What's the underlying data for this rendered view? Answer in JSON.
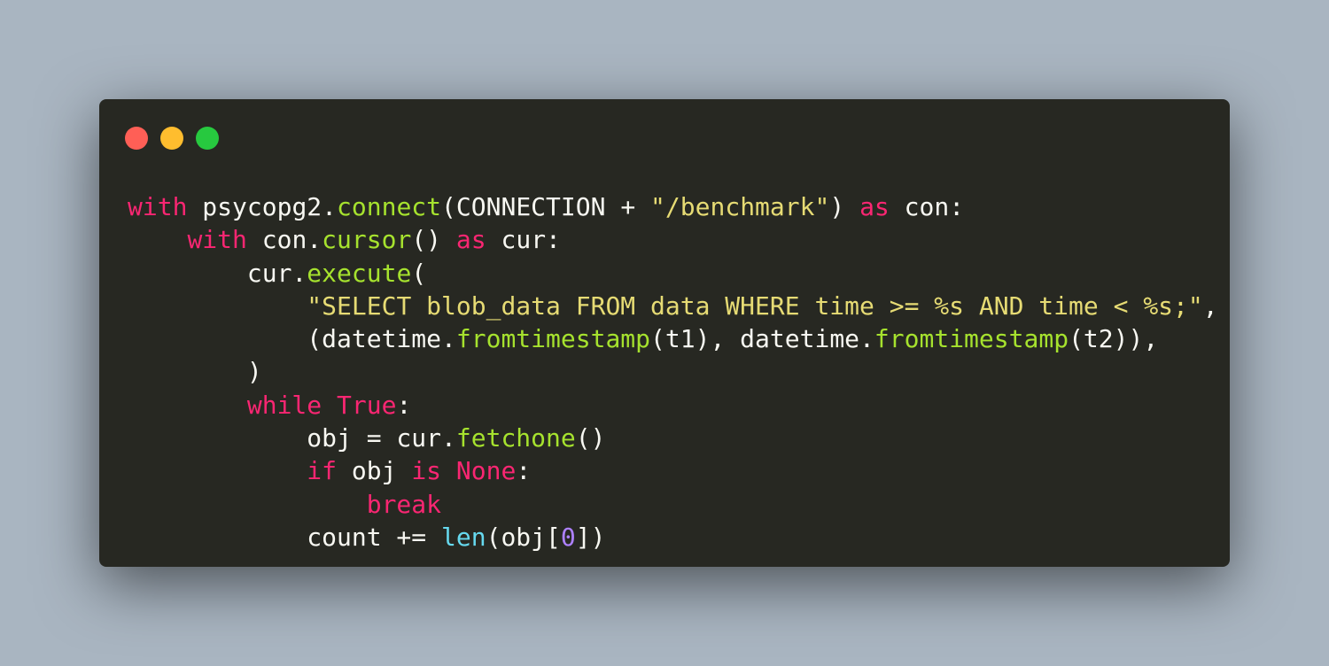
{
  "window": {
    "controls": [
      {
        "name": "close",
        "color": "#ff5f56"
      },
      {
        "name": "minimize",
        "color": "#ffbd2e"
      },
      {
        "name": "maximize",
        "color": "#27c93f"
      }
    ],
    "background": "#272822"
  },
  "colors": {
    "keyword": "#f92672",
    "function": "#a6e22e",
    "string": "#e6db74",
    "builtin": "#66d9ef",
    "number": "#ae81ff",
    "text": "#f8f8f2"
  },
  "code": [
    [
      [
        "kw",
        "with"
      ],
      [
        "txt",
        " psycopg2."
      ],
      [
        "fn",
        "connect"
      ],
      [
        "txt",
        "(CONNECTION + "
      ],
      [
        "str",
        "\"/benchmark\""
      ],
      [
        "txt",
        ") "
      ],
      [
        "kw",
        "as"
      ],
      [
        "txt",
        " con:"
      ]
    ],
    [
      [
        "txt",
        "    "
      ],
      [
        "kw",
        "with"
      ],
      [
        "txt",
        " con."
      ],
      [
        "fn",
        "cursor"
      ],
      [
        "txt",
        "() "
      ],
      [
        "kw",
        "as"
      ],
      [
        "txt",
        " cur:"
      ]
    ],
    [
      [
        "txt",
        "        cur."
      ],
      [
        "fn",
        "execute"
      ],
      [
        "txt",
        "("
      ]
    ],
    [
      [
        "txt",
        "            "
      ],
      [
        "str",
        "\"SELECT blob_data FROM data WHERE time >= %s AND time < %s;\""
      ],
      [
        "txt",
        ","
      ]
    ],
    [
      [
        "txt",
        "            (datetime."
      ],
      [
        "fn",
        "fromtimestamp"
      ],
      [
        "txt",
        "(t1), datetime."
      ],
      [
        "fn",
        "fromtimestamp"
      ],
      [
        "txt",
        "(t2)),"
      ]
    ],
    [
      [
        "txt",
        "        )"
      ]
    ],
    [
      [
        "txt",
        "        "
      ],
      [
        "kw",
        "while"
      ],
      [
        "txt",
        " "
      ],
      [
        "kw",
        "True"
      ],
      [
        "txt",
        ":"
      ]
    ],
    [
      [
        "txt",
        "            obj = cur."
      ],
      [
        "fn",
        "fetchone"
      ],
      [
        "txt",
        "()"
      ]
    ],
    [
      [
        "txt",
        "            "
      ],
      [
        "kw",
        "if"
      ],
      [
        "txt",
        " obj "
      ],
      [
        "kw",
        "is"
      ],
      [
        "txt",
        " "
      ],
      [
        "kw",
        "None"
      ],
      [
        "txt",
        ":"
      ]
    ],
    [
      [
        "txt",
        "                "
      ],
      [
        "kw",
        "break"
      ]
    ],
    [
      [
        "txt",
        "            count += "
      ],
      [
        "bi",
        "len"
      ],
      [
        "txt",
        "(obj["
      ],
      [
        "num",
        "0"
      ],
      [
        "txt",
        "])"
      ]
    ]
  ]
}
